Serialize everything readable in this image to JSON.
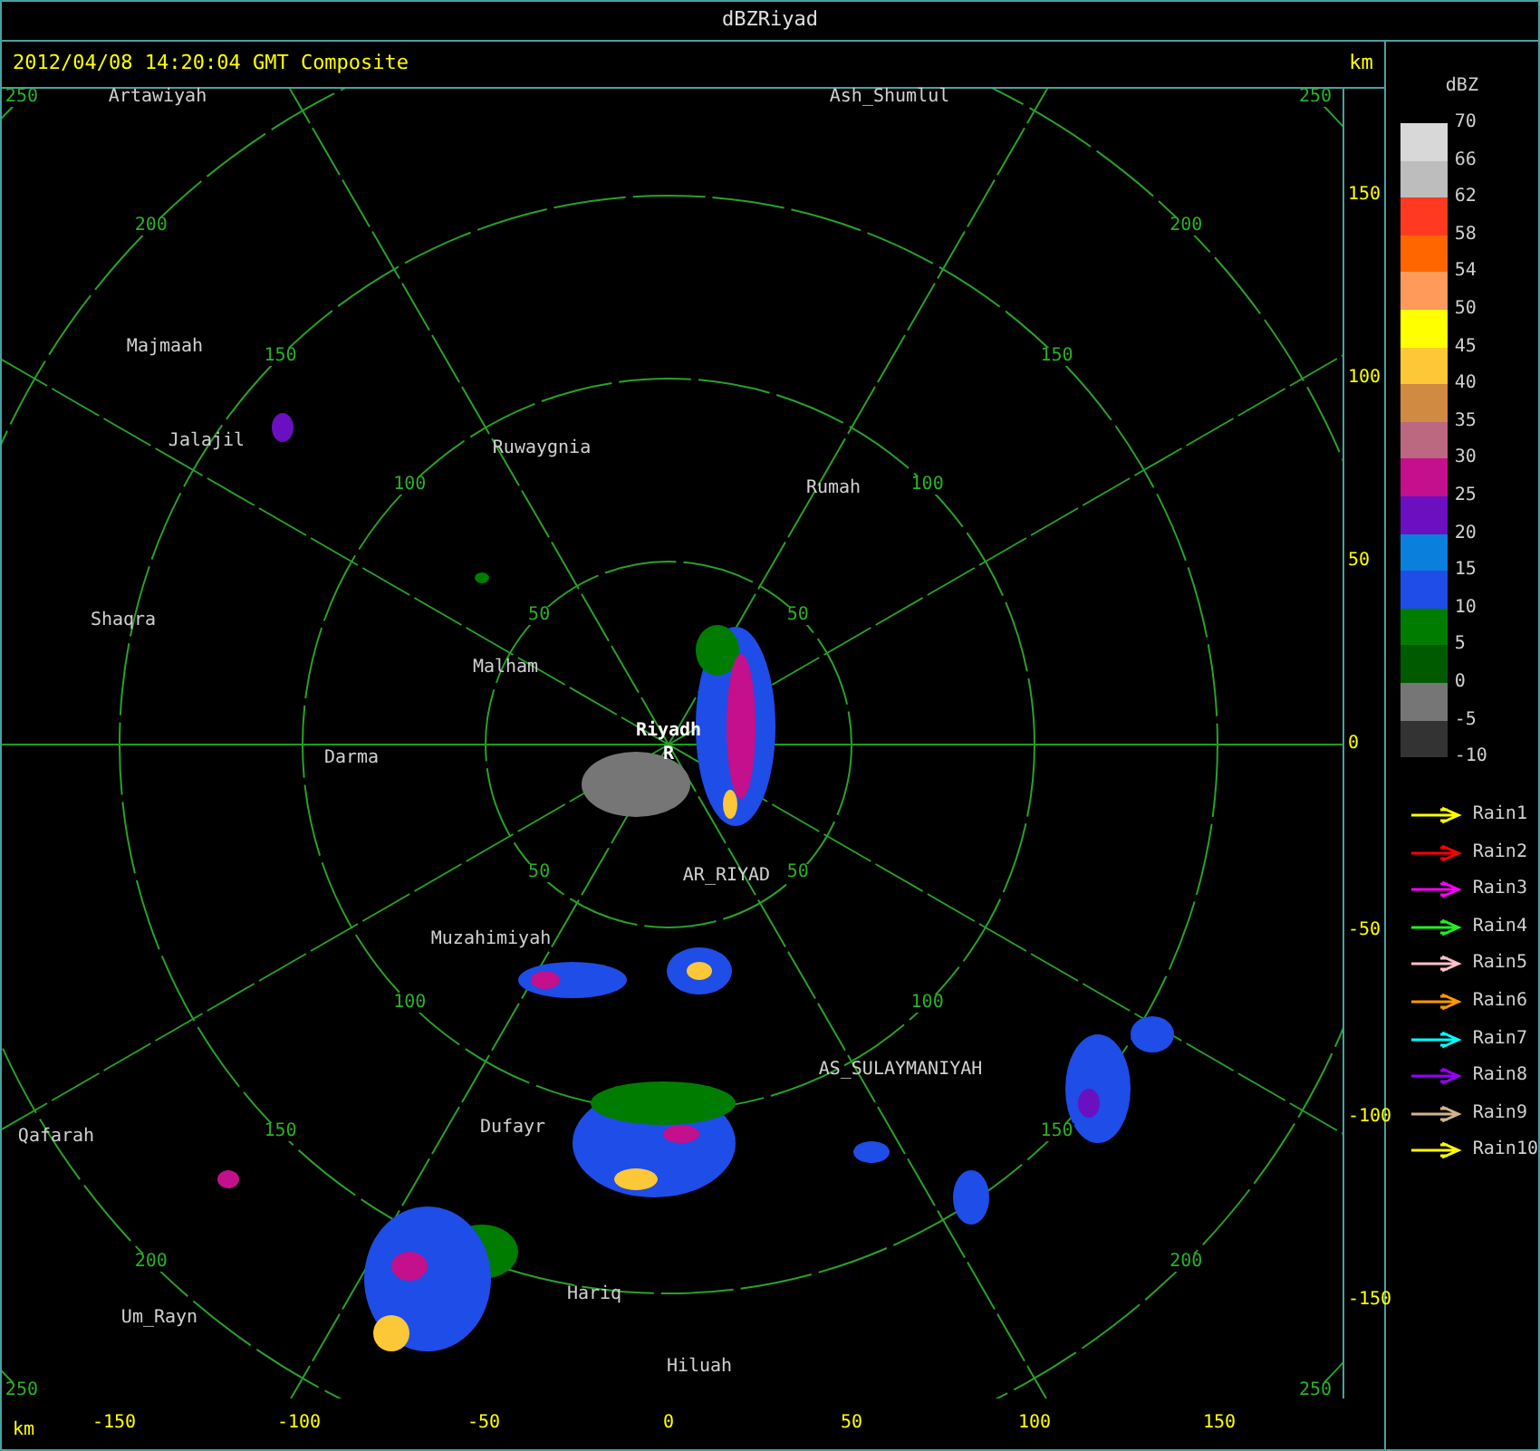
{
  "window": {
    "title": "dBZRiyad"
  },
  "header": {
    "timestamp": "2012/04/08 14:20:04 GMT Composite",
    "unit": "km"
  },
  "range_rings": [
    {
      "labels": [
        "50",
        "50",
        "50",
        "50"
      ]
    },
    {
      "labels": [
        "100",
        "100",
        "100",
        "100"
      ]
    },
    {
      "labels": [
        "150",
        "150",
        "150",
        "150"
      ]
    },
    {
      "labels": [
        "200",
        "200",
        "200",
        "200"
      ]
    },
    {
      "labels": [
        "250",
        "250",
        "250",
        "250"
      ]
    }
  ],
  "places": [
    {
      "name": "Artawiyah",
      "kind": "town"
    },
    {
      "name": "Ash_Shumlul",
      "kind": "town"
    },
    {
      "name": "Majmaah",
      "kind": "town"
    },
    {
      "name": "Jalajil",
      "kind": "town"
    },
    {
      "name": "Ruwaygnia",
      "kind": "town"
    },
    {
      "name": "Rumah",
      "kind": "town"
    },
    {
      "name": "Shaqra",
      "kind": "town"
    },
    {
      "name": "Malham",
      "kind": "town"
    },
    {
      "name": "Darma",
      "kind": "town"
    },
    {
      "name": "Riyadh",
      "kind": "radar"
    },
    {
      "name": "R",
      "kind": "radar"
    },
    {
      "name": "AR_RIYAD",
      "kind": "town"
    },
    {
      "name": "Muzahimiyah",
      "kind": "town"
    },
    {
      "name": "AS_SULAYMANIYAH",
      "kind": "town"
    },
    {
      "name": "Dufayr",
      "kind": "town"
    },
    {
      "name": "Qafarah",
      "kind": "town"
    },
    {
      "name": "Um_Rayn",
      "kind": "town"
    },
    {
      "name": "Hariq",
      "kind": "town"
    },
    {
      "name": "Hiluah",
      "kind": "town"
    }
  ],
  "y_axis": [
    "150",
    "100",
    "50",
    "0",
    "-50",
    "-100",
    "-150"
  ],
  "x_axis": {
    "unit": "km",
    "ticks": [
      "-150",
      "-100",
      "-50",
      "0",
      "50",
      "100",
      "150"
    ]
  },
  "legend": {
    "title": "dBZ",
    "labels": [
      "70",
      "66",
      "62",
      "58",
      "54",
      "50",
      "45",
      "40",
      "35",
      "30",
      "25",
      "20",
      "15",
      "10",
      "5",
      "0",
      "-5",
      "-10"
    ],
    "bins": [
      {
        "color": "#d8d8d8"
      },
      {
        "color": "#bdbdbd"
      },
      {
        "color": "#ff3a20"
      },
      {
        "color": "#ff6600"
      },
      {
        "color": "#ff9a5a"
      },
      {
        "color": "#ffff00"
      },
      {
        "color": "#fcc837"
      },
      {
        "color": "#d08a42"
      },
      {
        "color": "#bc6880"
      },
      {
        "color": "#c4108c"
      },
      {
        "color": "#6a10c0"
      },
      {
        "color": "#0a80dc"
      },
      {
        "color": "#1e4de8"
      },
      {
        "color": "#007d00"
      },
      {
        "color": "#005a00"
      },
      {
        "color": "#767676"
      },
      {
        "color": "#333333"
      }
    ]
  },
  "tracks": [
    {
      "name": "Rain1",
      "color": "#ffff00"
    },
    {
      "name": "Rain2",
      "color": "#ff0000"
    },
    {
      "name": "Rain3",
      "color": "#ff00ff"
    },
    {
      "name": "Rain4",
      "color": "#22ee22"
    },
    {
      "name": "Rain5",
      "color": "#ffc0cb"
    },
    {
      "name": "Rain6",
      "color": "#ff9900"
    },
    {
      "name": "Rain7",
      "color": "#00ffff"
    },
    {
      "name": "Rain8",
      "color": "#9900ff"
    },
    {
      "name": "Rain9",
      "color": "#d2b48c"
    },
    {
      "name": "Rain10",
      "color": "#ffff00"
    }
  ]
}
